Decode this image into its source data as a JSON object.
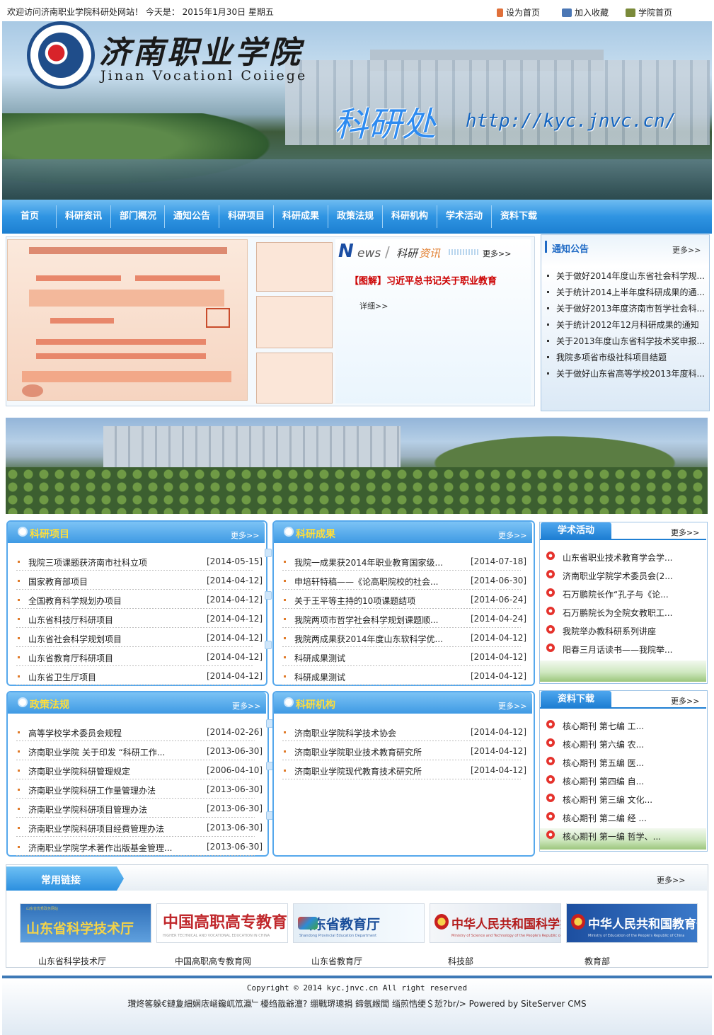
{
  "topbar": {
    "welcome": "欢迎访问济南职业学院科研处网站！ 今天是： 2015年1月30日   星期五",
    "set_home": "设为首页",
    "add_fav": "加入收藏",
    "college_home": "学院首页"
  },
  "banner": {
    "school_cn": "济南职业学院",
    "school_en": "Jinan Vocationl Coiiege",
    "dept": "科研处",
    "url": "http://kyc.jnvc.cn/"
  },
  "nav": [
    "首页",
    "科研资讯",
    "部门概况",
    "通知公告",
    "科研项目",
    "科研成果",
    "政策法规",
    "科研机构",
    "学术活动",
    "资料下载"
  ],
  "news": {
    "logo_n": "N",
    "logo_ews": "ews",
    "logo_slash": "/",
    "logo_cn1": "科研",
    "logo_cn2": "资讯",
    "more": "更多>>",
    "headline": "【图解】习近平总书记关于职业教育",
    "detail": "详细>>"
  },
  "notice": {
    "title": "通知公告",
    "more": "更多>>",
    "items": [
      "关于做好2014年度山东省社会科学规...",
      "关于统计2014上半年度科研成果的通...",
      "关于做好2013年度济南市哲学社会科...",
      "关于统计2012年12月科研成果的通知",
      "关于2013年度山东省科学技术奖申报...",
      "我院多项省市级社科项目结题",
      "关于做好山东省高等学校2013年度科..."
    ]
  },
  "projects": {
    "title": "科研项目",
    "more": "更多>>",
    "rows": [
      {
        "t": "我院三项课题获济南市社科立项",
        "d": "[2014-05-15]"
      },
      {
        "t": "国家教育部项目",
        "d": "[2014-04-12]"
      },
      {
        "t": "全国教育科学规划办项目",
        "d": "[2014-04-12]"
      },
      {
        "t": "山东省科技厅科研项目",
        "d": "[2014-04-12]"
      },
      {
        "t": "山东省社会科学规划项目",
        "d": "[2014-04-12]"
      },
      {
        "t": "山东省教育厅科研项目",
        "d": "[2014-04-12]"
      },
      {
        "t": "山东省卫生厅项目",
        "d": "[2014-04-12]"
      }
    ]
  },
  "results": {
    "title": "科研成果",
    "more": "更多>>",
    "rows": [
      {
        "t": "我院一成果获2014年职业教育国家级...",
        "d": "[2014-07-18]"
      },
      {
        "t": "申培轩特稿——《论高职院校的社会...",
        "d": "[2014-06-30]"
      },
      {
        "t": "关于王平等主持的10项课题结项",
        "d": "[2014-06-24]"
      },
      {
        "t": "我院两项市哲学社会科学规划课题顺...",
        "d": "[2014-04-24]"
      },
      {
        "t": "我院两成果获2014年度山东软科学优...",
        "d": "[2014-04-12]"
      },
      {
        "t": "科研成果测试",
        "d": "[2014-04-12]"
      },
      {
        "t": "科研成果测试",
        "d": "[2014-04-12]"
      }
    ]
  },
  "activities": {
    "title": "学术活动",
    "more": "更多>>",
    "items": [
      "山东省职业技术教育学会学...",
      "济南职业学院学术委员会(2...",
      "石万鹏院长作“孔子与《论...",
      "石万鹏院长为全院女教职工...",
      "我院举办教科研系列讲座",
      "阳春三月话读书——我院举..."
    ]
  },
  "policies": {
    "title": "政策法规",
    "more": "更多>>",
    "rows": [
      {
        "t": "高等学校学术委员会规程",
        "d": "[2014-02-26]"
      },
      {
        "t": "济南职业学院 关于印发 “科研工作...",
        "d": "[2013-06-30]"
      },
      {
        "t": "济南职业学院科研管理规定",
        "d": "[2006-04-10]"
      },
      {
        "t": "济南职业学院科研工作量管理办法",
        "d": "[2013-06-30]"
      },
      {
        "t": "济南职业学院科研项目管理办法",
        "d": "[2013-06-30]"
      },
      {
        "t": "济南职业学院科研项目经费管理办法",
        "d": "[2013-06-30]"
      },
      {
        "t": "济南职业学院学术著作出版基金管理...",
        "d": "[2013-06-30]"
      }
    ]
  },
  "institutes": {
    "title": "科研机构",
    "more": "更多>>",
    "rows": [
      {
        "t": "济南职业学院科学技术协会",
        "d": "[2014-04-12]"
      },
      {
        "t": "济南职业学院职业技术教育研究所",
        "d": "[2014-04-12]"
      },
      {
        "t": "济南职业学院现代教育技术研究所",
        "d": "[2014-04-12]"
      }
    ]
  },
  "downloads": {
    "title": "资料下载",
    "more": "更多>>",
    "items": [
      "核心期刊 第七编 工...",
      "核心期刊 第六编 农...",
      "核心期刊 第五编 医...",
      "核心期刊 第四编 自...",
      "核心期刊 第三编 文化...",
      "核心期刊 第二编      经 ...",
      "核心期刊 第一编 哲学、..."
    ]
  },
  "links": {
    "title": "常用链接",
    "more": "更多>>",
    "items": [
      {
        "logo": "山东省科学技术厅",
        "sub": "山东省优秀政务网站",
        "caption": "山东省科学技术厅"
      },
      {
        "logo": "中国高职高专教育网",
        "sub": "HIGHER TECHNICAL AND VOCATIONAL EDUCATION IN CHINA",
        "caption": "中国高职高专教育网"
      },
      {
        "logo": "山东省教育厅",
        "sub": "Shandong Provincial Education Department",
        "caption": "山东省教育厅"
      },
      {
        "logo": "中华人民共和国科学技术部",
        "sub": "Ministry of Science and Technology of the People's Republic of China",
        "caption": "科技部"
      },
      {
        "logo": "中华人民共和国教育部",
        "sub": "Ministry of Education of the People's Republic of China",
        "caption": "教育部"
      }
    ]
  },
  "footer": {
    "copyright": "Copyright © 2014 kyc.jnvc.cn All right reserved",
    "garble": "瓚炵笿躲€鏈夐細娴庡崡鑱屼笟瀛﹂櫌绉戠爺澶? 绷戰琾璁捐  鍗氬緱闆  缁煎悎绠＄悊?br/> Powered by SiteServer CMS"
  },
  "colors": {
    "nav": "#2f94e2",
    "accent": "#1f6ac5",
    "panel_title": "#ffde3a",
    "headline": "#cc0000"
  }
}
